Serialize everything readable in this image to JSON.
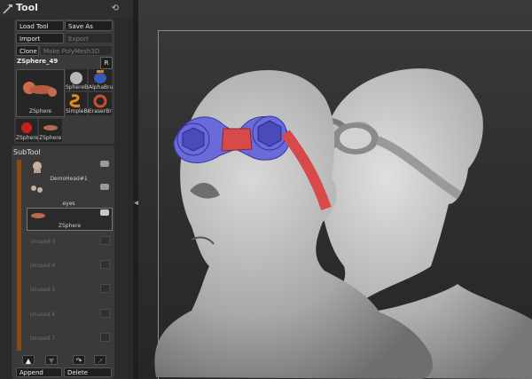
{
  "tool": {
    "title": "Tool",
    "buttons": {
      "load_tool": "Load Tool",
      "save_as": "Save As",
      "import": "Import",
      "export": "Export",
      "clone": "Clone",
      "make_polymesh": "Make PolyMesh3D"
    },
    "current_tool": "ZSphere_49",
    "r_button": "R",
    "thumbnails": [
      {
        "label": "ZSphere"
      },
      {
        "label": "SphereBr"
      },
      {
        "label": "AlphaBru"
      },
      {
        "label": "SimpleBru"
      },
      {
        "label": "EraserBr"
      },
      {
        "label": "ZSphere1"
      },
      {
        "label": "ZSphere"
      }
    ]
  },
  "subtool": {
    "title": "SubTool",
    "items": [
      {
        "label": "DemoHead#1"
      },
      {
        "label": "eyes"
      },
      {
        "label": "ZSphere"
      }
    ],
    "unused": [
      "Unused 3",
      "Unused 4",
      "Unused 5",
      "Unused 6",
      "Unused 7"
    ],
    "append": "Append",
    "delete": "Delete"
  },
  "colors": {
    "panel": "#2a2a2a",
    "strip": "#8a4a14",
    "zsphere_blue": "#6a6ad8",
    "zsphere_red": "#d84a4a"
  }
}
